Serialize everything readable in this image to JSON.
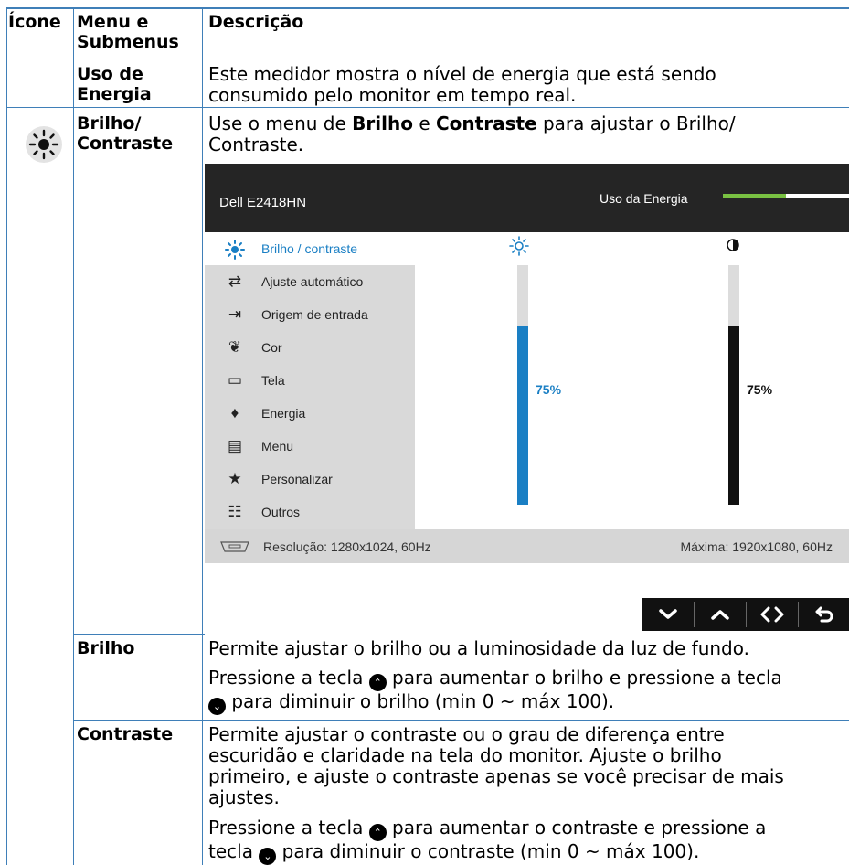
{
  "table": {
    "headers": {
      "icon": "Ícone",
      "menu_line1": "Menu e",
      "menu_line2": "Submenus",
      "desc": "Descrição"
    },
    "row_energy": {
      "name_line1": "Uso de",
      "name_line2": "Energia",
      "desc_line1": "Este medidor mostra o nível de energia que está sendo",
      "desc_line2": "consumido pelo monitor em tempo real."
    },
    "row_brightness": {
      "name_line1": "Brilho/",
      "name_line2": "Contraste",
      "desc_prefix": "Use o menu de ",
      "desc_bold1": "Brilho",
      "desc_mid": " e ",
      "desc_bold2": "Contraste",
      "desc_suffix": " para ajustar o Brilho/",
      "desc_line2": "Contraste."
    },
    "row_brilho": {
      "name": "Brilho",
      "desc1": "Permite ajustar o brilho ou a luminosidade da luz de fundo.",
      "desc2a": "Pressione a tecla ",
      "desc2b": " para aumentar o brilho e pressione a tecla",
      "desc3": " para diminuir o brilho (min 0 ~ máx 100)."
    },
    "row_contraste": {
      "name": "Contraste",
      "desc1": "Permite ajustar o contraste ou o grau de diferença entre",
      "desc2": "escuridão e claridade na tela do monitor. Ajuste o brilho",
      "desc3": "primeiro, e ajuste o contraste apenas se você precisar de mais",
      "desc4": "ajustes.",
      "desc5a": "Pressione a tecla ",
      "desc5b": " para aumentar o contraste e pressione a",
      "desc6a": "tecla ",
      "desc6b": " para diminuir o contraste (min 0 ~ máx 100)."
    }
  },
  "osd": {
    "model": "Dell E2418HN",
    "energy_label": "Uso da Energia",
    "energy_level": 0.5,
    "menu": [
      {
        "label": "Brilho / contraste",
        "icon": "sun-icon",
        "active": true
      },
      {
        "label": "Ajuste automático",
        "icon": "auto-adjust-icon"
      },
      {
        "label": "Origem de entrada",
        "icon": "input-source-icon"
      },
      {
        "label": "Cor",
        "icon": "color-icon"
      },
      {
        "label": "Tela",
        "icon": "display-icon"
      },
      {
        "label": "Energia",
        "icon": "energy-icon"
      },
      {
        "label": "Menu",
        "icon": "menu-icon"
      },
      {
        "label": "Personalizar",
        "icon": "star-icon"
      },
      {
        "label": "Outros",
        "icon": "others-icon"
      }
    ],
    "brightness": {
      "value": 75,
      "label": "75%",
      "color": "#1a7fc4"
    },
    "contrast": {
      "value": 75,
      "label": "75%",
      "color": "#111111"
    },
    "resolution": "Resolução: 1280x1024, 60Hz",
    "max_resolution": "Máxima: 1920x1080, 60Hz",
    "nav": [
      "down-icon",
      "up-icon",
      "left-right-icon",
      "back-icon"
    ]
  }
}
